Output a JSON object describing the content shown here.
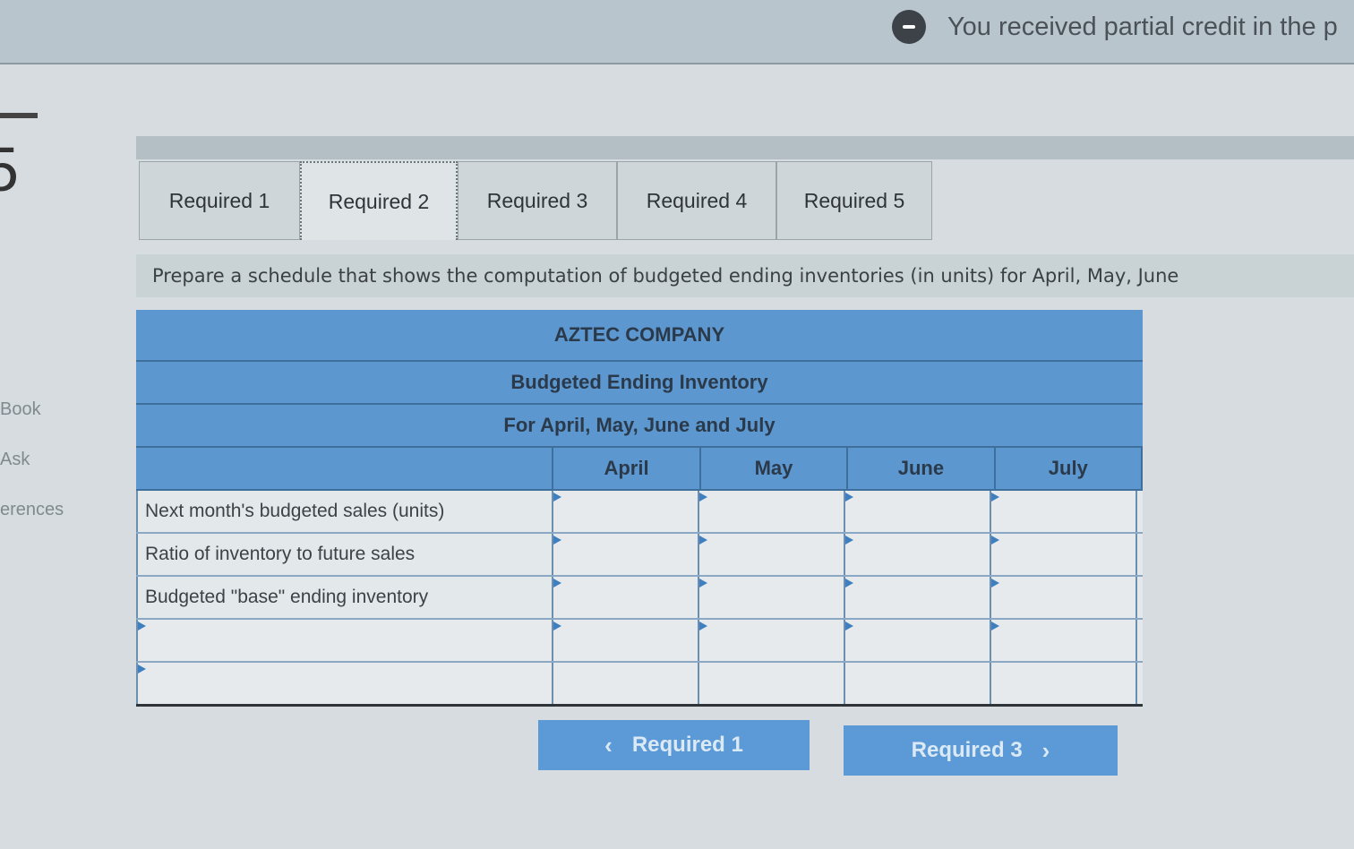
{
  "banner": {
    "credit_text": "You received partial credit in the p"
  },
  "question": {
    "number": "5"
  },
  "sidebar": {
    "items": [
      {
        "label": "Book"
      },
      {
        "label": "Ask"
      },
      {
        "label": "erences"
      }
    ]
  },
  "tabs": [
    {
      "label": "Required 1"
    },
    {
      "label": "Required 2"
    },
    {
      "label": "Required 3"
    },
    {
      "label": "Required 4"
    },
    {
      "label": "Required 5"
    }
  ],
  "instruction": "Prepare a schedule that shows the computation of budgeted ending inventories (in units) for April, May, June",
  "schedule": {
    "company": "AZTEC COMPANY",
    "title": "Budgeted Ending Inventory",
    "period": "For April, May, June and July",
    "columns": [
      "April",
      "May",
      "June",
      "July"
    ],
    "rows": [
      {
        "label": "Next month's budgeted sales (units)"
      },
      {
        "label": "Ratio of inventory to future sales"
      },
      {
        "label": "Budgeted \"base\" ending inventory"
      },
      {
        "label": ""
      },
      {
        "label": ""
      }
    ]
  },
  "nav": {
    "prev_label": "Required 1",
    "next_label": "Required 3"
  },
  "colors": {
    "header_blue": "#5d97cf",
    "button_blue": "#5b9ad6"
  }
}
